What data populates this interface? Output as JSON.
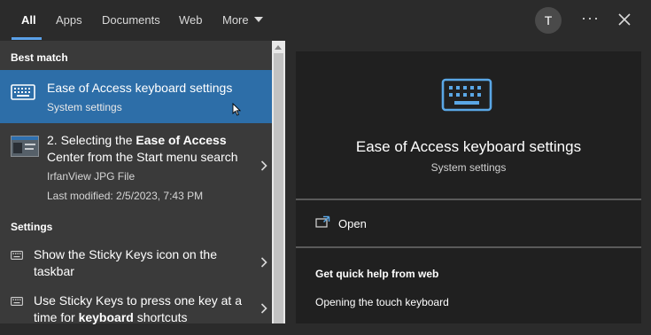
{
  "tabs": [
    {
      "label": "All",
      "active": true
    },
    {
      "label": "Apps"
    },
    {
      "label": "Documents"
    },
    {
      "label": "Web"
    },
    {
      "label": "More"
    }
  ],
  "account": {
    "initial": "T"
  },
  "menu": {
    "dots": "···"
  },
  "left": {
    "best_match_label": "Best match",
    "best": {
      "title": "Ease of Access keyboard settings",
      "subtitle": "System settings",
      "icon": "keyboard-icon"
    },
    "result2": {
      "line1_pre": "2. Selecting the ",
      "line1_bold": "Ease of Access",
      "line2": "Center from the Start menu search",
      "type": "IrfanView JPG File",
      "modified": "Last modified: 2/5/2023, 7:43 PM"
    },
    "settings_label": "Settings",
    "settings": [
      {
        "line1": "Show the Sticky Keys icon on the",
        "line2": "taskbar"
      },
      {
        "line1": "Use Sticky Keys to press one key at a",
        "line2_pre": "time for ",
        "line2_bold": "keyboard",
        "line2_post": " shortcuts"
      }
    ]
  },
  "preview": {
    "icon": "keyboard-icon",
    "title": "Ease of Access keyboard settings",
    "subtitle": "System settings",
    "open_label": "Open",
    "help_heading": "Get quick help from web",
    "help_link": "Opening the touch keyboard"
  },
  "colors": {
    "accent": "#2d6ea8",
    "tab_indicator": "#5aa0e8",
    "icon_blue": "#5aa7e6"
  }
}
